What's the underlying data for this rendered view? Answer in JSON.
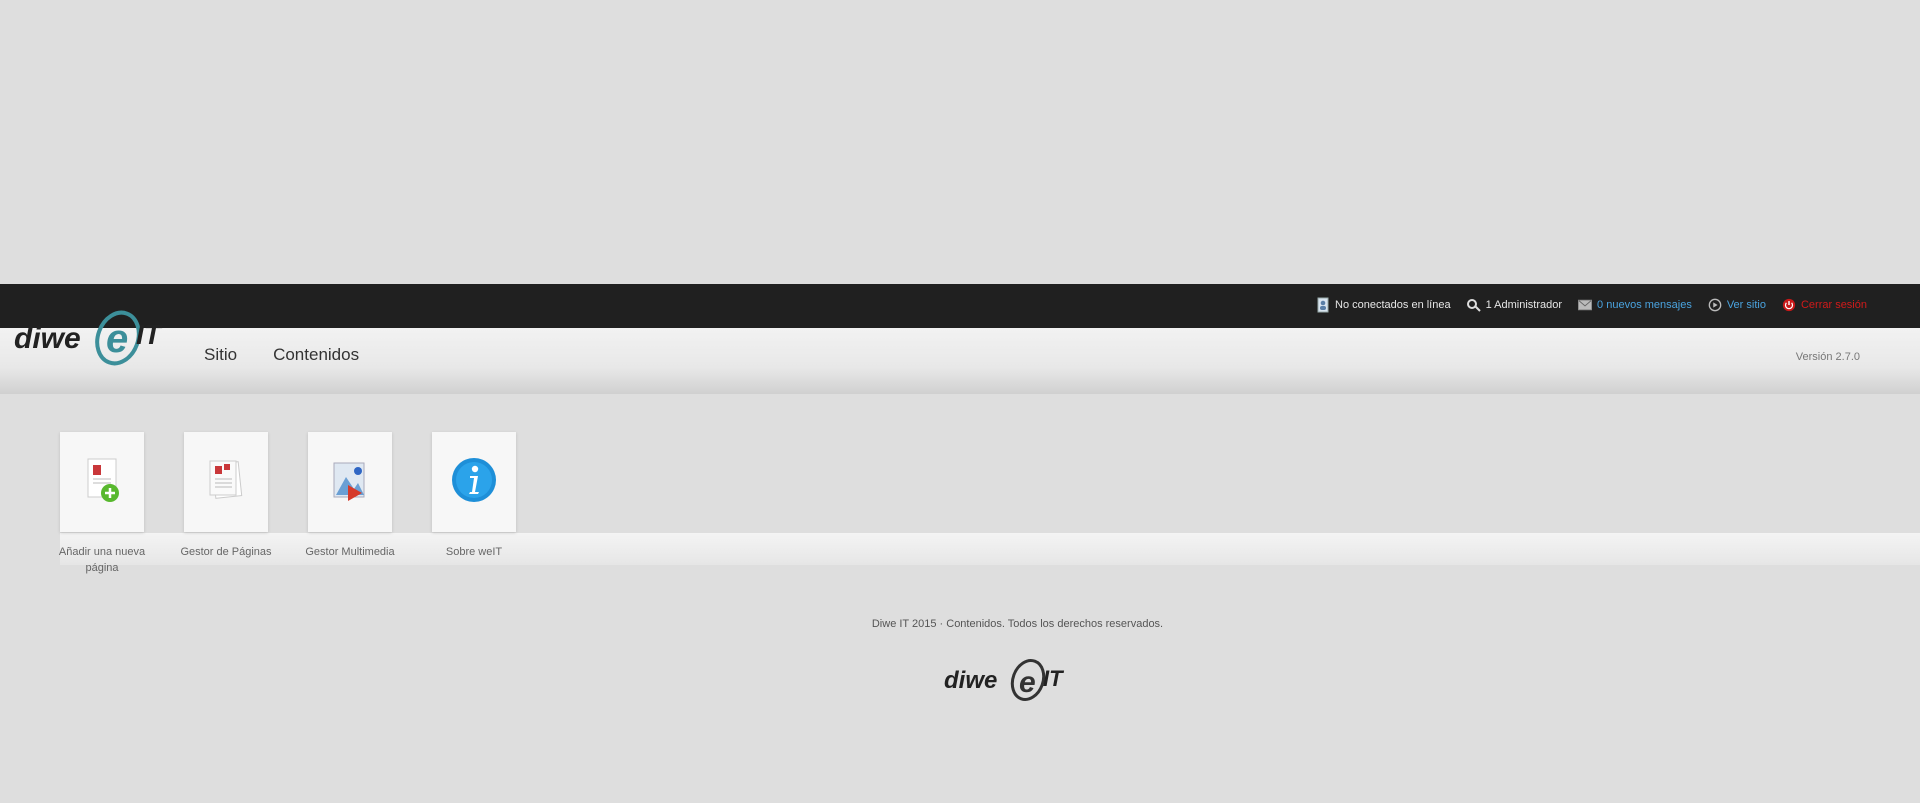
{
  "topbar": {
    "links": [
      {
        "label": "No conectados en línea",
        "icon": "users-page-icon",
        "color": "#e6e6e6"
      },
      {
        "label": "1 Administrador",
        "icon": "user-key-icon",
        "color": "#e6e6e6"
      },
      {
        "label": "0 nuevos mensajes",
        "icon": "mail-icon",
        "color": "#4aa3df"
      },
      {
        "label": "Ver sitio",
        "icon": "view-site-icon",
        "color": "#4aa3df"
      },
      {
        "label": "Cerrar sesión",
        "icon": "logout-icon",
        "color": "#d11a1a"
      }
    ]
  },
  "brand": {
    "logo_text": "diweIT"
  },
  "menu": {
    "items": [
      "Sitio",
      "Contenidos"
    ]
  },
  "version": "Versión 2.7.0",
  "shortcuts": [
    {
      "label": "Añadir una nueva página",
      "icon": "add-page-icon"
    },
    {
      "label": "Gestor de Páginas",
      "icon": "page-manager-icon"
    },
    {
      "label": "Gestor Multimedia",
      "icon": "media-manager-icon"
    },
    {
      "label": "Sobre weIT",
      "icon": "info-icon"
    }
  ],
  "footer": {
    "text": "Diwe IT 2015 · Contenidos. Todos los derechos reservados.",
    "logo_text": "diweIT"
  },
  "colors": {
    "background": "#dedede",
    "topbar": "#202020",
    "link_blue": "#4aa3df",
    "logout_red": "#d11a1a"
  }
}
